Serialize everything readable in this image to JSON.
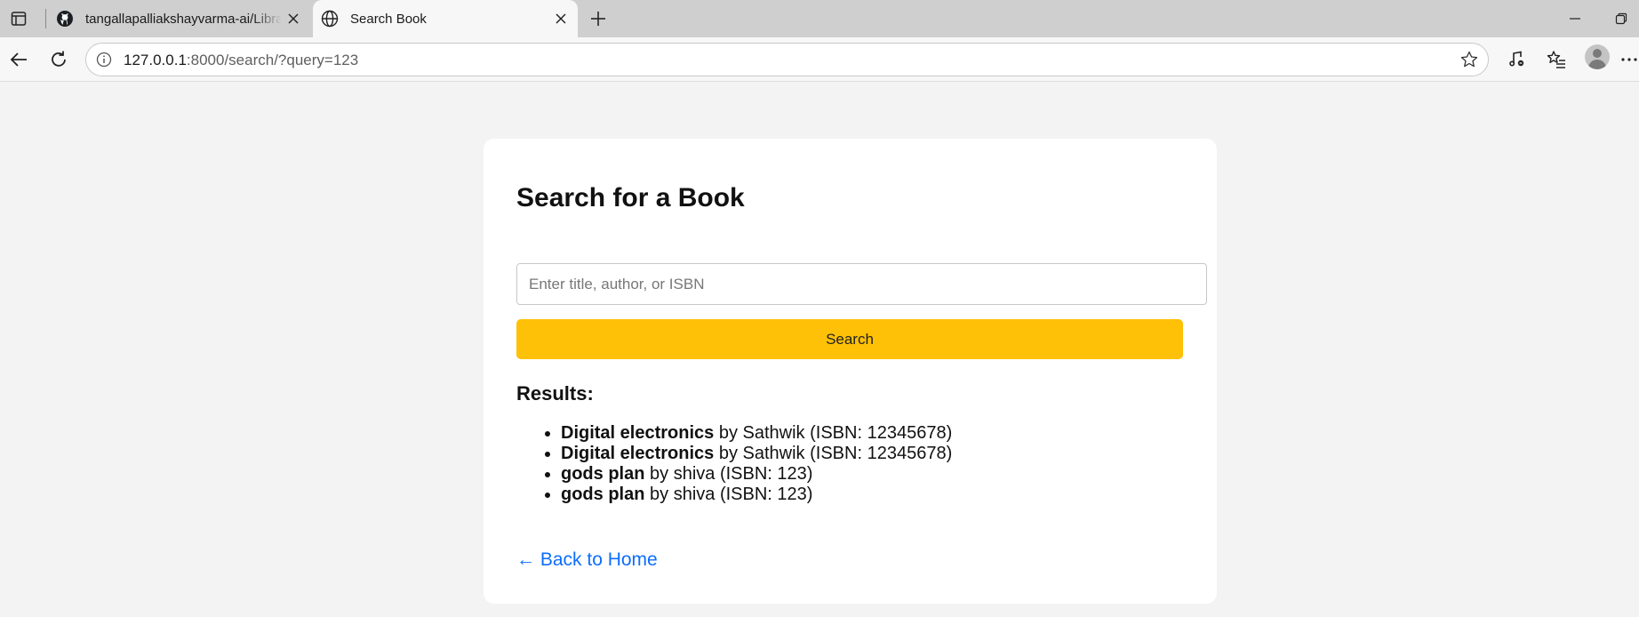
{
  "tabs": [
    {
      "title": "tangallapalliakshayvarma-ai/Library",
      "favicon": "github-icon",
      "active": false
    },
    {
      "title": "Search Book",
      "favicon": "globe-icon",
      "active": true
    }
  ],
  "address_bar": {
    "host": "127.0.0.1",
    "rest": ":8000/search/?query=123"
  },
  "page": {
    "heading": "Search for a Book",
    "search": {
      "placeholder": "Enter title, author, or ISBN",
      "value": "",
      "button_label": "Search"
    },
    "results_heading": "Results:",
    "results": [
      {
        "title": "Digital electronics",
        "author": "Sathwik",
        "isbn": "12345678"
      },
      {
        "title": "Digital electronics",
        "author": "Sathwik",
        "isbn": "12345678"
      },
      {
        "title": "gods plan",
        "author": "shiva",
        "isbn": "123"
      },
      {
        "title": "gods plan",
        "author": "shiva",
        "isbn": "123"
      }
    ],
    "result_by": " by ",
    "isbn_prefix": " (ISBN: ",
    "isbn_suffix": ")",
    "back_link": "← Back to Home"
  },
  "colors": {
    "accent_button": "#ffc107",
    "link": "#0d6efd",
    "page_bg": "#f3f3f3"
  }
}
